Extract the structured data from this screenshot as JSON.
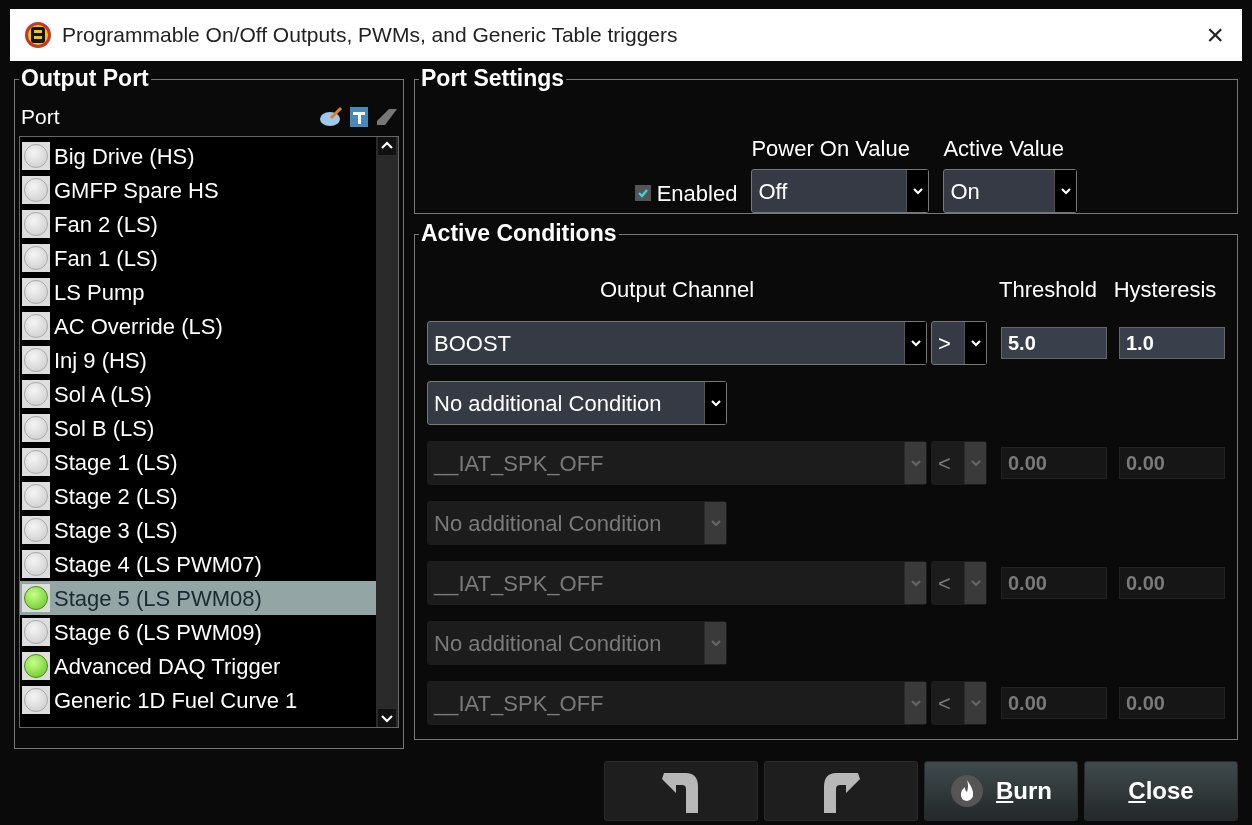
{
  "window": {
    "title": "Programmable On/Off Outputs, PWMs, and Generic Table triggers",
    "close": "×"
  },
  "output_port": {
    "title": "Output Port",
    "header": "Port",
    "ports": [
      {
        "name": "Big Drive (HS)",
        "active": false,
        "selected": false
      },
      {
        "name": "GMFP Spare HS",
        "active": false,
        "selected": false
      },
      {
        "name": "Fan 2 (LS)",
        "active": false,
        "selected": false
      },
      {
        "name": "Fan 1 (LS)",
        "active": false,
        "selected": false
      },
      {
        "name": "LS Pump",
        "active": false,
        "selected": false
      },
      {
        "name": "AC Override (LS)",
        "active": false,
        "selected": false
      },
      {
        "name": "Inj 9 (HS)",
        "active": false,
        "selected": false
      },
      {
        "name": "Sol A (LS)",
        "active": false,
        "selected": false
      },
      {
        "name": "Sol B (LS)",
        "active": false,
        "selected": false
      },
      {
        "name": "Stage 1 (LS)",
        "active": false,
        "selected": false
      },
      {
        "name": "Stage 2 (LS)",
        "active": false,
        "selected": false
      },
      {
        "name": "Stage 3 (LS)",
        "active": false,
        "selected": false
      },
      {
        "name": "Stage 4 (LS PWM07)",
        "active": false,
        "selected": false
      },
      {
        "name": "Stage 5 (LS PWM08)",
        "active": true,
        "selected": true
      },
      {
        "name": "Stage 6 (LS PWM09)",
        "active": false,
        "selected": false
      },
      {
        "name": "Advanced DAQ Trigger",
        "active": true,
        "selected": false
      },
      {
        "name": "Generic 1D Fuel Curve 1",
        "active": false,
        "selected": false
      }
    ]
  },
  "port_settings": {
    "title": "Port Settings",
    "enabled": {
      "label": "Enabled",
      "checked": true
    },
    "power_on_value": {
      "label": "Power On Value",
      "value": "Off"
    },
    "active_value": {
      "label": "Active Value",
      "value": "On"
    }
  },
  "active_conditions": {
    "title": "Active Conditions",
    "columns": [
      "Output Channel",
      "Threshold",
      "Hysteresis"
    ],
    "rows": [
      {
        "kind": "condition",
        "channel": "BOOST",
        "operator": ">",
        "threshold": "5.0",
        "hysteresis": "1.0",
        "disabled": false
      },
      {
        "kind": "connector",
        "value": "No additional Condition",
        "disabled": false
      },
      {
        "kind": "condition",
        "channel": "__IAT_SPK_OFF",
        "operator": "<",
        "threshold": "0.00",
        "hysteresis": "0.00",
        "disabled": true
      },
      {
        "kind": "connector",
        "value": "No additional Condition",
        "disabled": true
      },
      {
        "kind": "condition",
        "channel": "__IAT_SPK_OFF",
        "operator": "<",
        "threshold": "0.00",
        "hysteresis": "0.00",
        "disabled": true
      },
      {
        "kind": "connector",
        "value": "No additional Condition",
        "disabled": true
      },
      {
        "kind": "condition",
        "channel": "__IAT_SPK_OFF",
        "operator": "<",
        "threshold": "0.00",
        "hysteresis": "0.00",
        "disabled": true
      }
    ]
  },
  "buttons": [
    {
      "kind": "undo"
    },
    {
      "kind": "redo"
    },
    {
      "kind": "burn",
      "label": "Burn"
    },
    {
      "kind": "close",
      "label": "Close"
    }
  ]
}
